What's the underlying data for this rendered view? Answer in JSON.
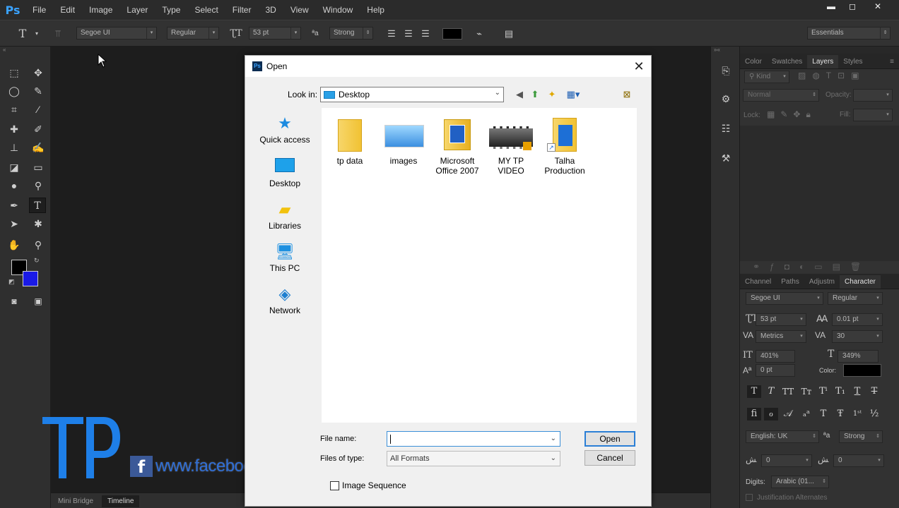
{
  "app": {
    "logo": "Ps"
  },
  "menu": [
    "File",
    "Edit",
    "Image",
    "Layer",
    "Type",
    "Select",
    "Filter",
    "3D",
    "View",
    "Window",
    "Help"
  ],
  "window_controls": {
    "minimize": "▬",
    "restore": "◻",
    "close": "✕"
  },
  "options_bar": {
    "font_family": "Segoe UI",
    "font_style": "Regular",
    "font_size": "53 pt",
    "antialias": "Strong",
    "workspace": "Essentials",
    "color": "#000000"
  },
  "tool_colors": {
    "foreground": "#000000",
    "background": "#1a1ae6"
  },
  "bottom_tabs": [
    "Mini Bridge",
    "Timeline"
  ],
  "layers_panel": {
    "tabs": [
      "Color",
      "Swatches",
      "Layers",
      "Styles"
    ],
    "active_tab": "Layers",
    "kind": "Kind",
    "blend_mode": "Normal",
    "opacity_label": "Opacity:",
    "lock_label": "Lock:",
    "fill_label": "Fill:"
  },
  "character_panel": {
    "tabs": [
      "Channel",
      "Paths",
      "Adjustm",
      "Character"
    ],
    "active_tab": "Character",
    "font_family": "Segoe UI",
    "font_style": "Regular",
    "font_size": "53 pt",
    "leading": "0.01 pt",
    "kerning": "Metrics",
    "tracking": "30",
    "vertical_scale": "401%",
    "horizontal_scale": "349%",
    "baseline_shift": "0 pt",
    "color_label": "Color:",
    "color": "#000000",
    "language": "English: UK",
    "antialias": "Strong",
    "field_a": "0",
    "field_b": "0",
    "digits_label": "Digits:",
    "digits_value": "Arabic (01...",
    "justification": "Justification Alternates"
  },
  "dialog": {
    "title": "Open",
    "look_in_label": "Look in:",
    "look_in_value": "Desktop",
    "places": [
      "Quick access",
      "Desktop",
      "Libraries",
      "This PC",
      "Network"
    ],
    "files": [
      {
        "name": "tp data",
        "icon": "folder-icon"
      },
      {
        "name": "images",
        "icon": "image-thumbnail-icon"
      },
      {
        "name": "Microsoft Office 2007",
        "icon": "office-folder-icon"
      },
      {
        "name": "MY TP VIDEO",
        "icon": "video-thumbnail-icon"
      },
      {
        "name": "Talha Production",
        "icon": "shortcut-folder-icon"
      }
    ],
    "file_name_label": "File name:",
    "file_name_value": "",
    "file_type_label": "Files of type:",
    "file_type_value": "All Formats",
    "open_button": "Open",
    "cancel_button": "Cancel",
    "image_sequence_label": "Image Sequence"
  },
  "watermark": {
    "logo": "TP",
    "facebook_url": "www.facebook.com/talhaproductiontp",
    "fb_letter": "f"
  }
}
